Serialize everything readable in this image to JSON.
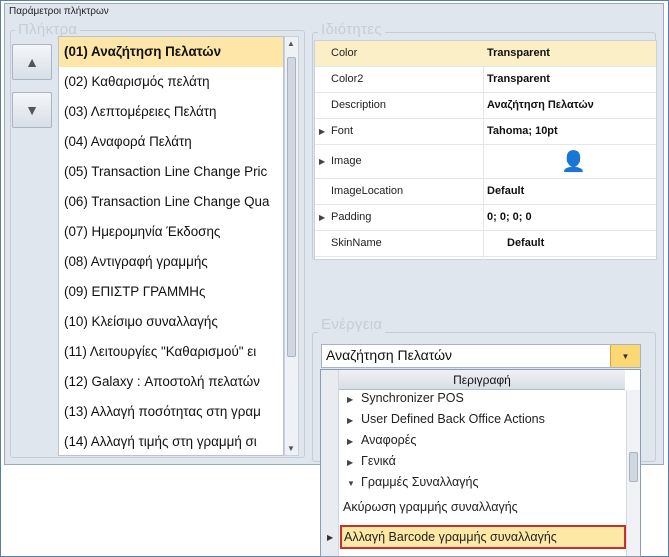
{
  "window": {
    "title": "Παράμετροι πλήκτρων"
  },
  "keys_group": {
    "label": "Πλήκτρα",
    "items": [
      "(01) Αναζήτηση Πελατών",
      "(02) Καθαρισμός πελάτη",
      "(03) Λεπτομέρειες Πελάτη",
      "(04) Αναφορά Πελάτη",
      "(05) Transaction Line Change Pric",
      "(06) Transaction Line Change Qua",
      "(07) Ημερομηνία Έκδοσης",
      "(08) Αντιγραφή γραμμής",
      "(09) ΕΠΙΣΤΡ ΓΡΑΜΜΗς",
      "(10) Κλείσιμο συναλλαγής",
      "(11) Λειτουργίες \"Καθαρισμού\" ει",
      "(12) Galaxy : Αποστολή πελατών",
      "(13) Αλλαγή ποσότητας στη γραμ",
      "(14) Αλλαγή τιμής στη γραμμή σι"
    ],
    "up_icon": "arrow-up-icon",
    "down_icon": "arrow-down-icon"
  },
  "properties_group": {
    "label": "Ιδιότητες",
    "rows": [
      {
        "name": "Color",
        "value": "Transparent",
        "expandable": false
      },
      {
        "name": "Color2",
        "value": "Transparent",
        "expandable": false
      },
      {
        "name": "Description",
        "value": "Αναζήτηση Πελατών",
        "expandable": false
      },
      {
        "name": "Font",
        "value": "Tahoma; 10pt",
        "expandable": true
      },
      {
        "name": "Image",
        "value": "",
        "expandable": true,
        "icon": "person-icon"
      },
      {
        "name": "ImageLocation",
        "value": "Default",
        "expandable": false
      },
      {
        "name": "Padding",
        "value": "0; 0; 0; 0",
        "expandable": true
      },
      {
        "name": "SkinName",
        "value": "Default",
        "expandable": false
      }
    ]
  },
  "action_group": {
    "label": "Ενέργεια",
    "combo_value": "Αναζήτηση Πελατών",
    "dropdown": {
      "header": "Περιγραφή",
      "items": [
        "Synchronizer POS",
        "User Defined Back Office Actions",
        "Αναφορές",
        "Γενικά",
        "Γραμμές Συναλλαγής",
        "Ακύρωση γραμμής συναλλαγής",
        "Αλλαγή Barcode γραμμής συναλλαγής"
      ]
    }
  },
  "colors": {
    "selection": "#fde6a8",
    "highlight_border": "#c8302e",
    "combo_button": "#fbd873"
  }
}
